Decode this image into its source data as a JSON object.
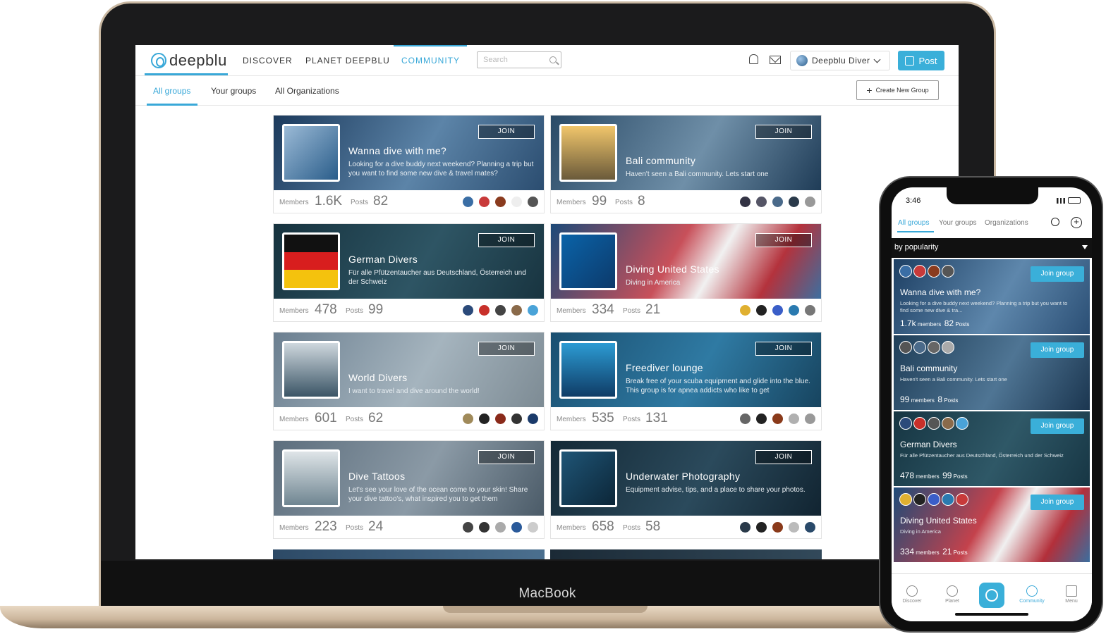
{
  "laptop": {
    "brand": "MacBook"
  },
  "web": {
    "logo": "deepblu",
    "nav": [
      "DISCOVER",
      "PLANET DEEPBLU",
      "COMMUNITY"
    ],
    "search_placeholder": "Search",
    "user_name": "Deepblu Diver",
    "post_label": "Post",
    "subnav": [
      "All groups",
      "Your groups",
      "All Organizations"
    ],
    "create_group_label": "Create New Group",
    "join_label": "JOIN",
    "members_label": "Members",
    "posts_label": "Posts",
    "groups": [
      {
        "title": "Wanna dive with me?",
        "desc": "Looking for a dive buddy next weekend? Planning a trip but you want to find some new dive & travel mates?",
        "members": "1.6K",
        "posts": "82"
      },
      {
        "title": "Bali community",
        "desc": "Haven't seen a Bali community. Lets start one",
        "members": "99",
        "posts": "8"
      },
      {
        "title": "German Divers",
        "desc": "Für alle Pfützentaucher aus Deutschland, Österreich und der Schweiz",
        "members": "478",
        "posts": "99"
      },
      {
        "title": "Diving United States",
        "desc": "Diving in America",
        "members": "334",
        "posts": "21"
      },
      {
        "title": "World Divers",
        "desc": "I want to travel and dive around the world!",
        "members": "601",
        "posts": "62"
      },
      {
        "title": "Freediver lounge",
        "desc": "Break free of your scuba equipment and glide into the blue. This group is for apnea addicts who like to get",
        "members": "535",
        "posts": "131"
      },
      {
        "title": "Dive Tattoos",
        "desc": "Let's see your love of the ocean come to your skin! Share your dive tattoo's, what inspired you to get them",
        "members": "223",
        "posts": "24"
      },
      {
        "title": "Underwater Photography",
        "desc": "Equipment advise, tips, and a place to share your photos.",
        "members": "658",
        "posts": "58"
      }
    ]
  },
  "phone": {
    "time": "3:46",
    "tabs": [
      "All groups",
      "Your groups",
      "Organizations"
    ],
    "sort_label": "by popularity",
    "join_label": "Join group",
    "members_word": "members",
    "posts_word": "Posts",
    "groups": [
      {
        "title": "Wanna dive with me?",
        "desc": "Looking for a dive buddy next weekend? Planning a trip but you want to find some new dive & tra...",
        "members": "1.7k",
        "posts": "82"
      },
      {
        "title": "Bali community",
        "desc": "Haven't seen a Bali community. Lets start one",
        "members": "99",
        "posts": "8"
      },
      {
        "title": "German Divers",
        "desc": "Für alle Pfützentaucher aus Deutschland, Österreich und der Schweiz",
        "members": "478",
        "posts": "99"
      },
      {
        "title": "Diving United States",
        "desc": "Diving in America",
        "members": "334",
        "posts": "21"
      }
    ],
    "bottom_nav": [
      "Discover",
      "Planet",
      "Community",
      "Menu"
    ]
  }
}
